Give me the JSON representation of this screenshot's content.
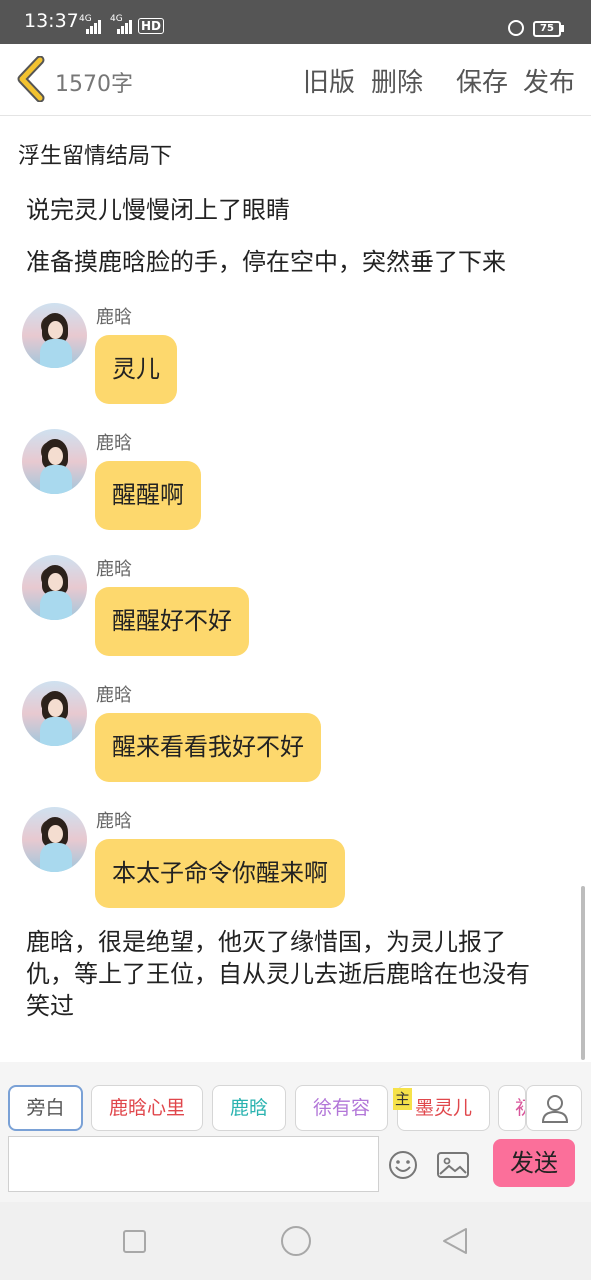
{
  "status_bar": {
    "time": "13:37",
    "signal1_label": "4G",
    "signal2_label": "4G",
    "hd_label": "HD",
    "battery": "75"
  },
  "header": {
    "word_count": "1570字",
    "old_version_label": "旧版",
    "delete_label": "删除",
    "save_label": "保存",
    "publish_label": "发布"
  },
  "story_title": "浮生留情结局下",
  "content": {
    "narration_top": [
      "说完灵儿慢慢闭上了眼睛",
      "准备摸鹿晗脸的手，停在空中，突然垂了下来"
    ],
    "messages": [
      {
        "speaker": "鹿晗",
        "text": "灵儿"
      },
      {
        "speaker": "鹿晗",
        "text": "醒醒啊"
      },
      {
        "speaker": "鹿晗",
        "text": "醒醒好不好"
      },
      {
        "speaker": "鹿晗",
        "text": "醒来看看我好不好"
      },
      {
        "speaker": "鹿晗",
        "text": "本太子命令你醒来啊"
      }
    ],
    "narration_bottom": [
      "鹿晗，很是绝望，他灭了缘惜国，为灵儿报了",
      "仇，等上了王位，自从灵儿去逝后鹿晗在也没有",
      "笑过"
    ]
  },
  "characters": [
    {
      "label": "旁白",
      "color": "#555555",
      "active": true
    },
    {
      "label": "鹿晗心里",
      "color": "#e0474c",
      "active": false
    },
    {
      "label": "鹿晗",
      "color": "#2bb3b0",
      "active": false
    },
    {
      "label": "徐有容",
      "color": "#b276d8",
      "active": false
    },
    {
      "label": "墨灵儿",
      "color": "#e0474c",
      "active": false
    },
    {
      "label": "初",
      "color": "#d9569b",
      "active": false
    }
  ],
  "host_badge": "主",
  "input": {
    "placeholder": "",
    "value": ""
  },
  "send_label": "发送",
  "icons": [
    "back-chevron-icon",
    "lock-icon",
    "battery-icon",
    "person-icon",
    "emoji-icon",
    "image-icon",
    "nav-recent-icon",
    "nav-home-icon",
    "nav-back-icon"
  ],
  "colors": {
    "bubble": "#fdd86d",
    "send": "#fb6f9a",
    "back_chevron": "#f2c230",
    "status_bar": "#555555"
  }
}
